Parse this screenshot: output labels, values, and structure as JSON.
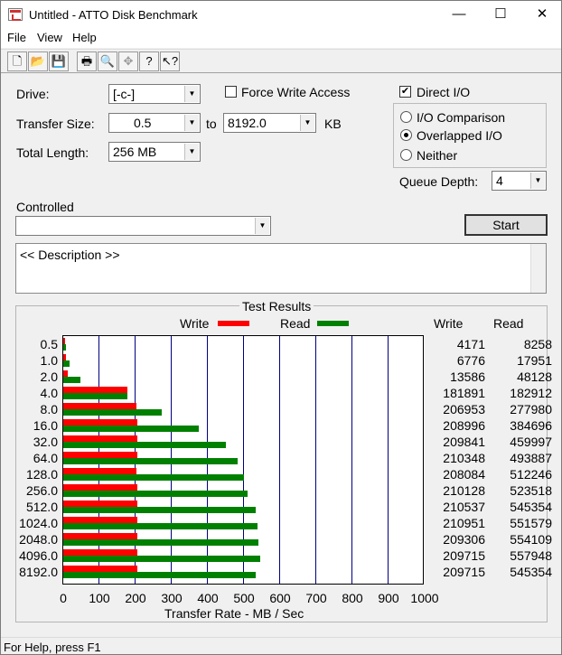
{
  "window": {
    "title": "Untitled - ATTO Disk Benchmark",
    "minimize": "—",
    "maximize": "☐",
    "close": "✕"
  },
  "menu": [
    "File",
    "View",
    "Help"
  ],
  "toolbar": [
    "new-icon",
    "open-icon",
    "save-icon",
    "print-icon",
    "print-preview-icon",
    "move-icon",
    "help-icon",
    "context-help-icon"
  ],
  "settings": {
    "drive_label": "Drive:",
    "drive_value": "[-c-]",
    "force_write_label": "Force Write Access",
    "force_write_checked": false,
    "direct_io_label": "Direct I/O",
    "direct_io_checked": true,
    "transfer_size_label": "Transfer Size:",
    "transfer_from": "0.5",
    "to_label": "to",
    "transfer_to": "8192.0",
    "kb_label": "KB",
    "total_length_label": "Total Length:",
    "total_length_value": "256 MB",
    "io_options": [
      "I/O Comparison",
      "Overlapped I/O",
      "Neither"
    ],
    "io_selected": "Overlapped I/O",
    "queue_depth_label": "Queue Depth:",
    "queue_depth_value": "4",
    "controlled_label": "Controlled",
    "controlled_value": "",
    "start_label": "Start",
    "description": "<< Description >>"
  },
  "results": {
    "title": "Test Results",
    "legend_write": "Write",
    "legend_read": "Read",
    "col_write": "Write",
    "col_read": "Read",
    "colors": {
      "write": "#ff0000",
      "read": "#008000"
    }
  },
  "chart_data": {
    "type": "bar",
    "orientation": "horizontal",
    "xlabel": "Transfer Rate - MB / Sec",
    "xlim": [
      0,
      1000
    ],
    "xticks": [
      "0",
      "100",
      "200",
      "300",
      "400",
      "500",
      "600",
      "700",
      "800",
      "900",
      "1000"
    ],
    "categories": [
      "0.5",
      "1.0",
      "2.0",
      "4.0",
      "8.0",
      "16.0",
      "32.0",
      "64.0",
      "128.0",
      "256.0",
      "512.0",
      "1024.0",
      "2048.0",
      "4096.0",
      "8192.0"
    ],
    "series": [
      {
        "name": "Write",
        "values": [
          4171,
          6776,
          13586,
          181891,
          206953,
          208996,
          209841,
          210348,
          208084,
          210128,
          210537,
          210951,
          209306,
          209715,
          209715
        ]
      },
      {
        "name": "Read",
        "values": [
          8258,
          17951,
          48128,
          182912,
          277980,
          384696,
          459997,
          493887,
          512246,
          523518,
          545354,
          551579,
          554109,
          557948,
          545354
        ]
      }
    ],
    "value_units": "KB/s"
  },
  "status": "For Help, press F1"
}
